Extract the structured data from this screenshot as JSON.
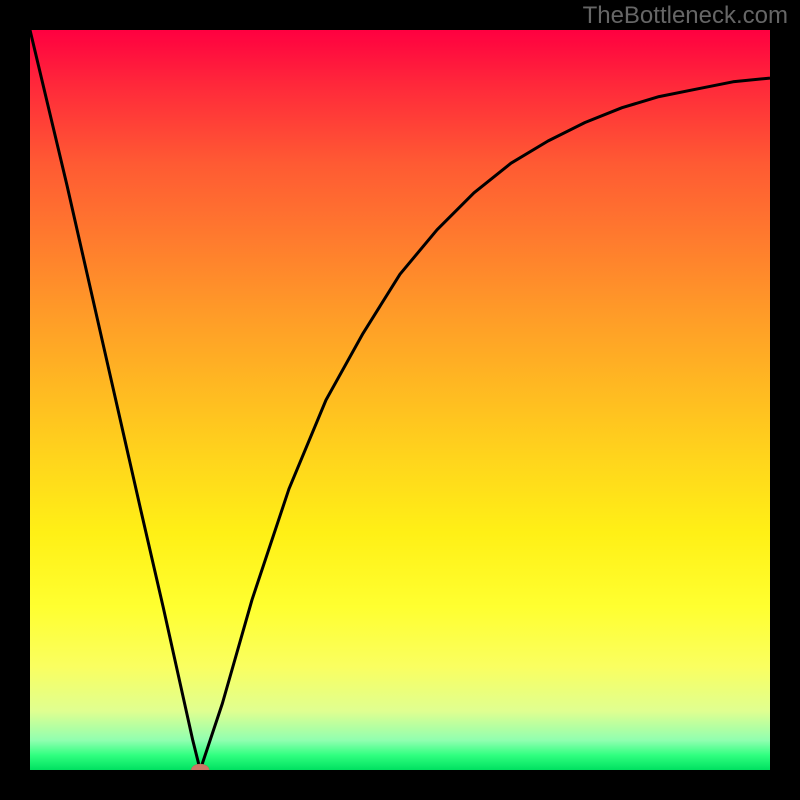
{
  "watermark": "TheBottleneck.com",
  "chart_data": {
    "type": "line",
    "title": "",
    "xlabel": "",
    "ylabel": "",
    "xlim": [
      0,
      100
    ],
    "ylim": [
      0,
      100
    ],
    "series": [
      {
        "name": "bottleneck-curve",
        "x": [
          0,
          5,
          10,
          15,
          18,
          20,
          22,
          23,
          26,
          30,
          35,
          40,
          45,
          50,
          55,
          60,
          65,
          70,
          75,
          80,
          85,
          90,
          95,
          100
        ],
        "y": [
          100,
          79,
          57,
          35,
          22,
          13,
          4,
          0,
          9,
          23,
          38,
          50,
          59,
          67,
          73,
          78,
          82,
          85,
          87.5,
          89.5,
          91,
          92,
          93,
          93.5
        ]
      }
    ],
    "marker": {
      "x": 23,
      "y": 0,
      "shape": "ellipse",
      "color": "#cc7766"
    },
    "background_gradient": {
      "direction": "top-to-bottom",
      "stops": [
        {
          "pos": 0,
          "color": "#ff0040"
        },
        {
          "pos": 50,
          "color": "#ffb822"
        },
        {
          "pos": 80,
          "color": "#ffff30"
        },
        {
          "pos": 100,
          "color": "#00e060"
        }
      ]
    }
  }
}
